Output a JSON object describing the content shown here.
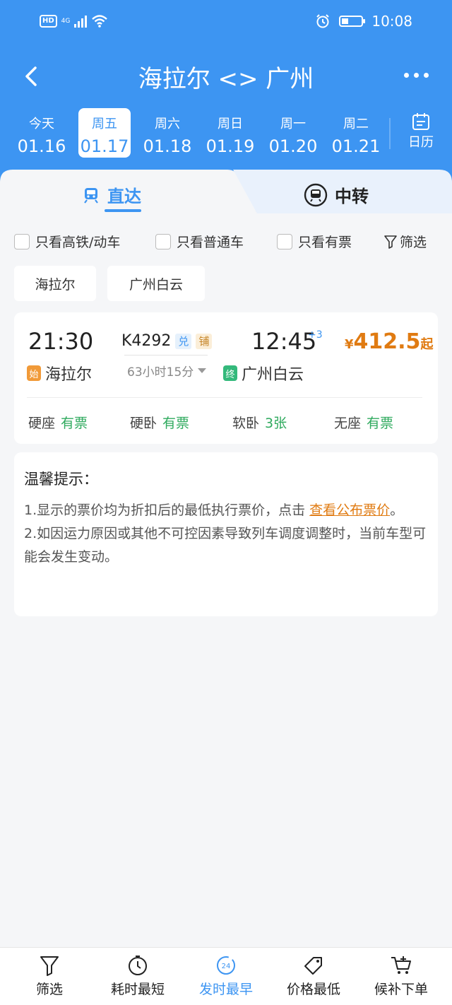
{
  "status_bar": {
    "hd": "HD",
    "network": "4G",
    "time": "10:08",
    "battery_level": 0.35
  },
  "header": {
    "title": "海拉尔 <> 广州"
  },
  "dates": [
    {
      "weekday": "今天",
      "date": "01.16",
      "active": false
    },
    {
      "weekday": "周五",
      "date": "01.17",
      "active": true
    },
    {
      "weekday": "周六",
      "date": "01.18",
      "active": false
    },
    {
      "weekday": "周日",
      "date": "01.19",
      "active": false
    },
    {
      "weekday": "周一",
      "date": "01.20",
      "active": false
    },
    {
      "weekday": "周二",
      "date": "01.21",
      "active": false
    }
  ],
  "calendar_label": "日历",
  "tabs": {
    "direct": "直达",
    "transfer": "中转"
  },
  "filters": {
    "high_speed": "只看高铁/动车",
    "normal": "只看普通车",
    "available": "只看有票",
    "filter_label": "筛选"
  },
  "station_chips": [
    "海拉尔",
    "广州白云"
  ],
  "train": {
    "depart_time": "21:30",
    "train_no": "K4292",
    "tag_exchange": "兑",
    "tag_berth": "铺",
    "arrive_time": "12:45",
    "days_plus": "+3",
    "price_symbol": "¥",
    "price": "412.5",
    "price_suffix": "起",
    "from_badge": "始",
    "from_station": "海拉尔",
    "duration": "63小时15分",
    "to_badge": "终",
    "to_station": "广州白云",
    "seats": [
      {
        "type": "硬座",
        "status": "有票"
      },
      {
        "type": "硬卧",
        "status": "有票"
      },
      {
        "type": "软卧",
        "status": "3张"
      },
      {
        "type": "无座",
        "status": "有票"
      }
    ]
  },
  "tips": {
    "title": "温馨提示：",
    "line1_text": "1.显示的票价均为折扣后的最低执行票价，点击 ",
    "line1_link": "查看公布票价",
    "line1_end": "。",
    "line2": "2.如因运力原因或其他不可控因素导致列车调度调整时，当前车型可能会发生变动。"
  },
  "bottom_bar": {
    "filter": "筛选",
    "shortest": "耗时最短",
    "earliest": "发时最早",
    "earliest_icon_text": "24",
    "cheapest": "价格最低",
    "waitlist": "候补下单"
  },
  "colors": {
    "primary": "#3d95f2",
    "price": "#e07b12",
    "available": "#2faa5e"
  }
}
